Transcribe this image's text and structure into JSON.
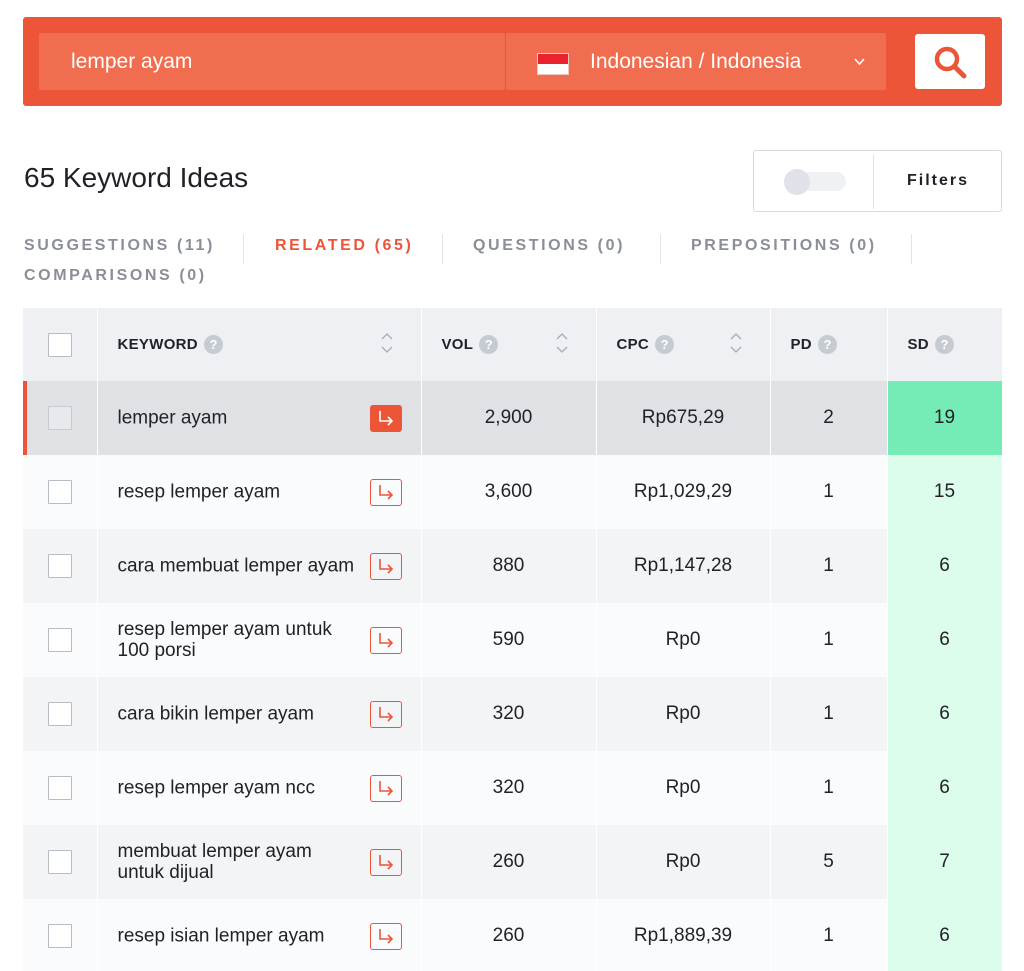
{
  "search": {
    "query": "lemper ayam",
    "language_label": "Indonesian / Indonesia"
  },
  "results": {
    "title": "65 Keyword Ideas",
    "filters_label": "Filters"
  },
  "tabs": [
    {
      "label": "SUGGESTIONS (11)",
      "active": false
    },
    {
      "label": "RELATED (65)",
      "active": true
    },
    {
      "label": "QUESTIONS (0)",
      "active": false
    },
    {
      "label": "PREPOSITIONS (0)",
      "active": false
    },
    {
      "label": "COMPARISONS (0)",
      "active": false
    }
  ],
  "table": {
    "headers": {
      "keyword": "KEYWORD",
      "vol": "VOL",
      "cpc": "CPC",
      "pd": "PD",
      "sd": "SD",
      "help": "?"
    },
    "rows": [
      {
        "keyword": "lemper ayam",
        "vol": "2,900",
        "cpc": "Rp675,29",
        "pd": "2",
        "sd": "19"
      },
      {
        "keyword": "resep lemper ayam",
        "vol": "3,600",
        "cpc": "Rp1,029,29",
        "pd": "1",
        "sd": "15"
      },
      {
        "keyword": "cara membuat lemper ayam",
        "vol": "880",
        "cpc": "Rp1,147,28",
        "pd": "1",
        "sd": "6"
      },
      {
        "keyword": "resep lemper ayam untuk 100 porsi",
        "vol": "590",
        "cpc": "Rp0",
        "pd": "1",
        "sd": "6"
      },
      {
        "keyword": "cara bikin lemper ayam",
        "vol": "320",
        "cpc": "Rp0",
        "pd": "1",
        "sd": "6"
      },
      {
        "keyword": "resep lemper ayam ncc",
        "vol": "320",
        "cpc": "Rp0",
        "pd": "1",
        "sd": "6"
      },
      {
        "keyword": "membuat lemper ayam untuk dijual",
        "vol": "260",
        "cpc": "Rp0",
        "pd": "5",
        "sd": "7"
      },
      {
        "keyword": "resep isian lemper ayam",
        "vol": "260",
        "cpc": "Rp1,889,39",
        "pd": "1",
        "sd": "6"
      }
    ]
  },
  "colors": {
    "brand": "#ec5538",
    "sd_high": "#75ebb5",
    "sd_low": "#dcfcec"
  },
  "icons": {
    "search": "search-icon",
    "chevron": "chevron-down-icon",
    "flag": "indonesia-flag-icon",
    "sort": "sort-icon",
    "help": "help-icon",
    "go": "go-to-keyword-icon"
  }
}
